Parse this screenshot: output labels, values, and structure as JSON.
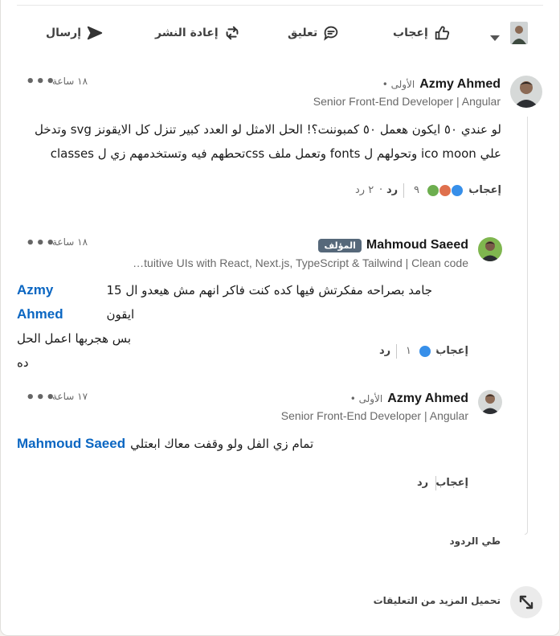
{
  "actions": {
    "send": "إرسال",
    "repost": "إعادة النشر",
    "comment": "تعليق",
    "like": "إعجاب"
  },
  "comments": [
    {
      "name": "Azmy Ahmed",
      "degree": "• الأولى",
      "headline": "Senior Front-End Developer | Angular",
      "time": "١٨ ساعة",
      "text_line1": "لو عندي ٥٠ ايكون هعمل ٥٠ كمبوننت؟! الحل الامثل لو العدد كبير تنزل كل الايقونز svg وتدخل",
      "text_line2": "علي ico moon وتحولهم ل fonts وتعمل ملف cssتحطهم فيه وتستخدمهم زي ل classes",
      "like_label": "إعجاب",
      "reaction_count": "٩",
      "reply_label": "رد",
      "replies_count": "٢ رد"
    },
    {
      "name": "Mahmoud Saeed",
      "author_badge": "المؤلف",
      "headline": "…tuitive UIs with React, Next.js, TypeScript & Tailwind | Clean code",
      "time": "١٨ ساعة",
      "mention": "Azmy Ahmed",
      "text_line1": "جامد بصراحه مفكرتش فيها كده كنت فاكر انهم مش هيعدو ال 15 ايقون",
      "text_line2": "بس هجربها اعمل الحل ده",
      "like_label": "إعجاب",
      "reaction_count": "١",
      "reply_label": "رد"
    },
    {
      "name": "Azmy Ahmed",
      "degree": "• الأولى",
      "headline": "Senior Front-End Developer | Angular",
      "time": "١٧ ساعة",
      "mention": "Mahmoud Saeed",
      "text_line1": "تمام زي الفل ولو وقفت معاك ابعتلي",
      "like_label": "إعجاب",
      "reply_label": "رد"
    }
  ],
  "collapse_replies": "طي الردود",
  "load_more": "تحميل المزيد من التعليقات",
  "colors": {
    "link": "#0a66c2",
    "badge": "#56687a",
    "like_blue": "#378fe9",
    "love_red": "#df704d",
    "support_green": "#6dae4f"
  }
}
